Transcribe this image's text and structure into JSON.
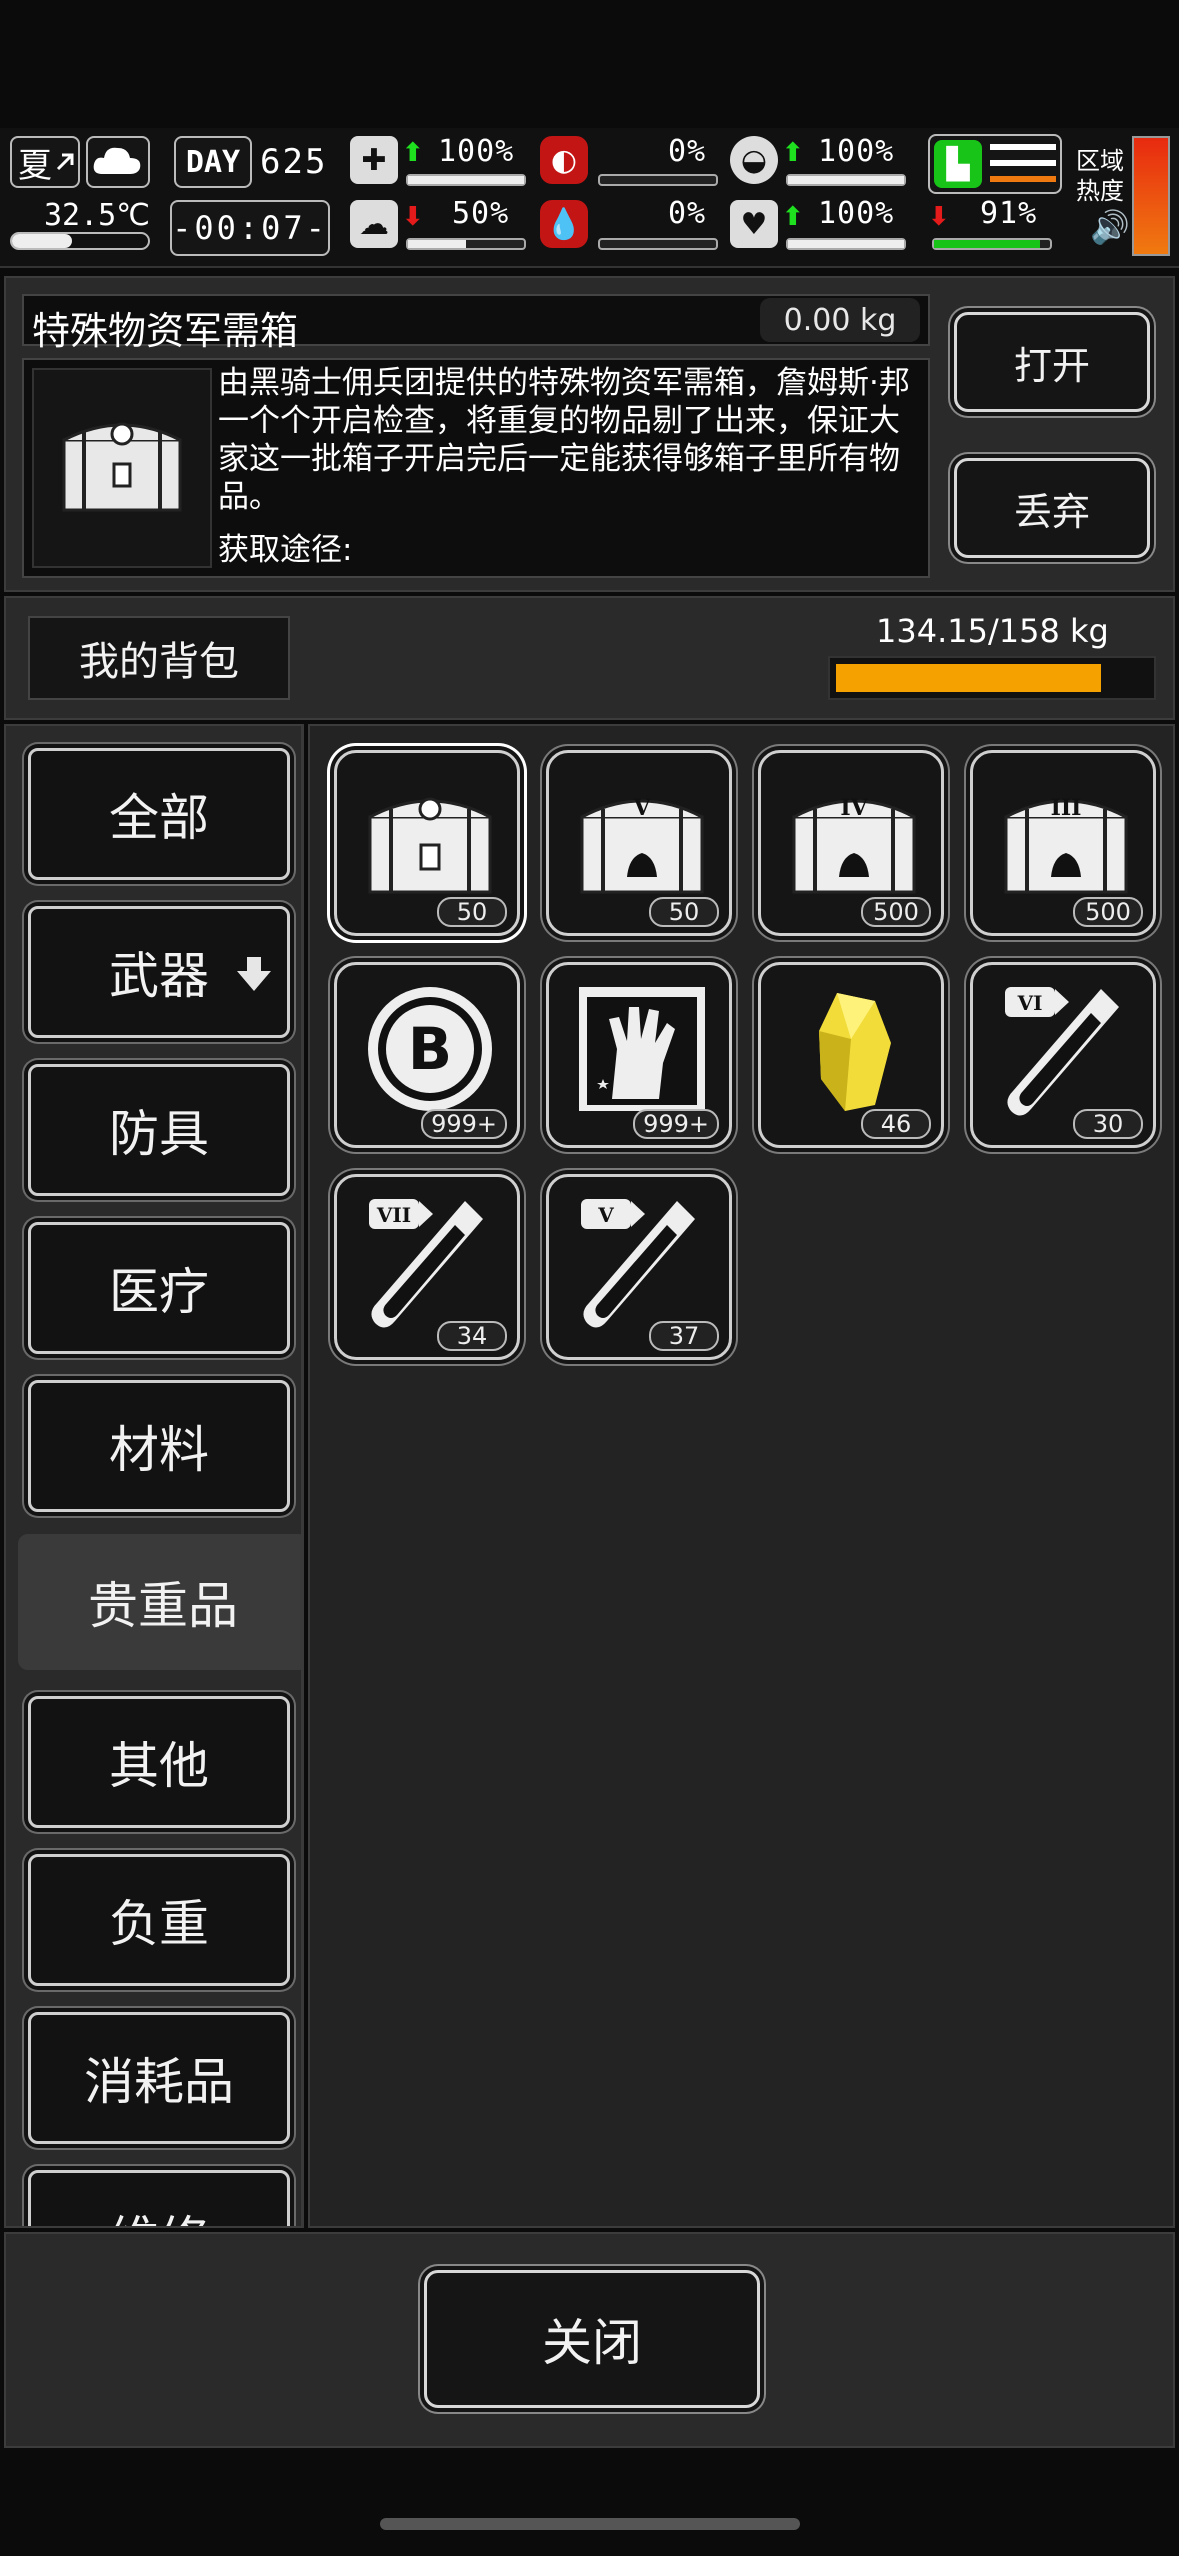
{
  "status": {
    "season": "夏",
    "temperature": "32.5℃",
    "day_label": "DAY",
    "day_number": "625",
    "clock": "-00:07-",
    "stats": {
      "health": {
        "value": "100%",
        "trend": "up",
        "fill": 1.0
      },
      "hunger": {
        "value": "0%",
        "fill": 0.0
      },
      "stamina": {
        "value": "100%",
        "trend": "up",
        "fill": 1.0
      },
      "energy": {
        "value": "100%",
        "trend": "up",
        "fill": 1.0
      },
      "mental": {
        "value": "50%",
        "trend": "down",
        "fill": 0.5
      },
      "bleeding": {
        "value": "0%",
        "fill": 0.0
      },
      "heart": {
        "value": "100%",
        "trend": "up",
        "fill": 1.0
      },
      "speed": {
        "value": "91%",
        "trend": "down",
        "fill": 0.91
      }
    },
    "zone_heat_label": "区域热度",
    "sound_icon": "speaker-icon"
  },
  "detail": {
    "item_name": "特殊物资军需箱",
    "item_weight": "0.00 kg",
    "description": "由黑骑士佣兵团提供的特殊物资军需箱，詹姆斯·邦一个个开启检查，将重复的物品剔了出来，保证大家这一批箱子开启完后一定能获得够箱子里所有物品。",
    "source_label": "获取途径:",
    "open_label": "打开",
    "discard_label": "丢弃"
  },
  "bag": {
    "tab_label": "我的背包",
    "weight_text": "134.15/158 kg",
    "weight_fill": 0.849
  },
  "categories": [
    {
      "label": "全部"
    },
    {
      "label": "武器"
    },
    {
      "label": "防具"
    },
    {
      "label": "医疗"
    },
    {
      "label": "材料"
    },
    {
      "label": "贵重品",
      "active": true
    },
    {
      "label": "其他"
    },
    {
      "label": "负重"
    },
    {
      "label": "消耗品"
    },
    {
      "label": "维修"
    }
  ],
  "items": [
    {
      "icon": "special-supply-crate-icon",
      "count": "50",
      "selected": true
    },
    {
      "icon": "supply-crate-v-icon",
      "count": "50",
      "tier": "V"
    },
    {
      "icon": "supply-crate-iv-icon",
      "count": "500",
      "tier": "IV"
    },
    {
      "icon": "supply-crate-iii-icon",
      "count": "500",
      "tier": "III"
    },
    {
      "icon": "bitcoin-coin-icon",
      "count": "999+",
      "symbol": "B"
    },
    {
      "icon": "zombie-hand-card-icon",
      "count": "999+"
    },
    {
      "icon": "gold-crystal-icon",
      "count": "46"
    },
    {
      "icon": "test-tube-vi-icon",
      "count": "30",
      "tier": "VI"
    },
    {
      "icon": "test-tube-vii-icon",
      "count": "34",
      "tier": "VII"
    },
    {
      "icon": "test-tube-v-icon",
      "count": "37",
      "tier": "V"
    }
  ],
  "footer": {
    "close_label": "关闭"
  },
  "colors": {
    "accent": "#f5a200",
    "heat_top": "#e82a10",
    "heat_bottom": "#f07a10"
  }
}
